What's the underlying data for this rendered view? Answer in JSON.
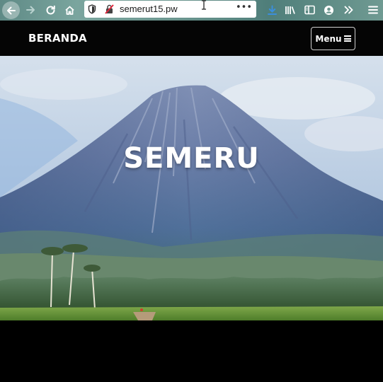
{
  "browser": {
    "url": "semerut15.pw",
    "more_label": "•••",
    "icons": [
      "back-arrow-icon",
      "forward-arrow-icon",
      "reload-icon",
      "home-icon",
      "shield-icon",
      "insecure-lock-icon",
      "download-icon",
      "library-icon",
      "sidebar-icon",
      "account-icon",
      "overflow-chevron-icon",
      "hamburger-menu-icon"
    ],
    "accent": "#3b8fdc"
  },
  "site": {
    "brand": "BERANDA",
    "menu_label": "Menu",
    "hero_title": "SEMERU"
  }
}
